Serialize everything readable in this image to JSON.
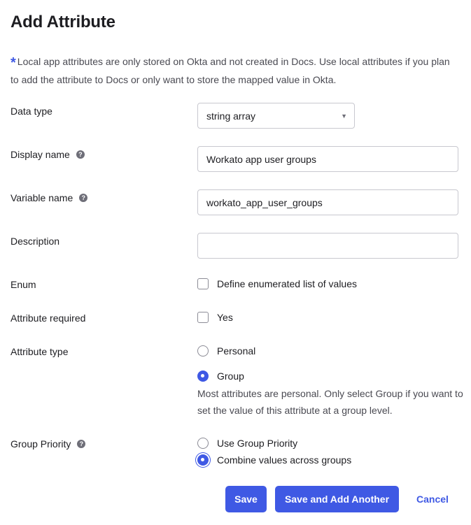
{
  "dialog": {
    "title": "Add Attribute",
    "notice": "Local app attributes are only stored on Okta and not created in Docs. Use local attributes if you plan to add the attribute to Docs or only want to store the mapped value in Okta."
  },
  "fields": {
    "data_type": {
      "label": "Data type",
      "value": "string array"
    },
    "display_name": {
      "label": "Display name",
      "value": "Workato app user groups"
    },
    "variable_name": {
      "label": "Variable name",
      "value": "workato_app_user_groups"
    },
    "description": {
      "label": "Description",
      "value": ""
    },
    "enum": {
      "label": "Enum",
      "option": "Define enumerated list of values",
      "checked": false
    },
    "attribute_required": {
      "label": "Attribute required",
      "option": "Yes",
      "checked": false
    },
    "attribute_type": {
      "label": "Attribute type",
      "options": [
        "Personal",
        "Group"
      ],
      "selected": "Group",
      "hint": "Most attributes are personal. Only select Group if you want to set the value of this attribute at a group level."
    },
    "group_priority": {
      "label": "Group Priority",
      "options": [
        "Use Group Priority",
        "Combine values across groups"
      ],
      "selected": "Combine values across groups"
    }
  },
  "buttons": {
    "save": "Save",
    "save_add_another": "Save and Add Another",
    "cancel": "Cancel"
  },
  "colors": {
    "accent": "#3f59e4",
    "text": "#1d1d21",
    "muted": "#4a4a52"
  },
  "icons": {
    "help": "help-circle-icon",
    "caret": "caret-down-icon",
    "required": "asterisk-icon"
  }
}
